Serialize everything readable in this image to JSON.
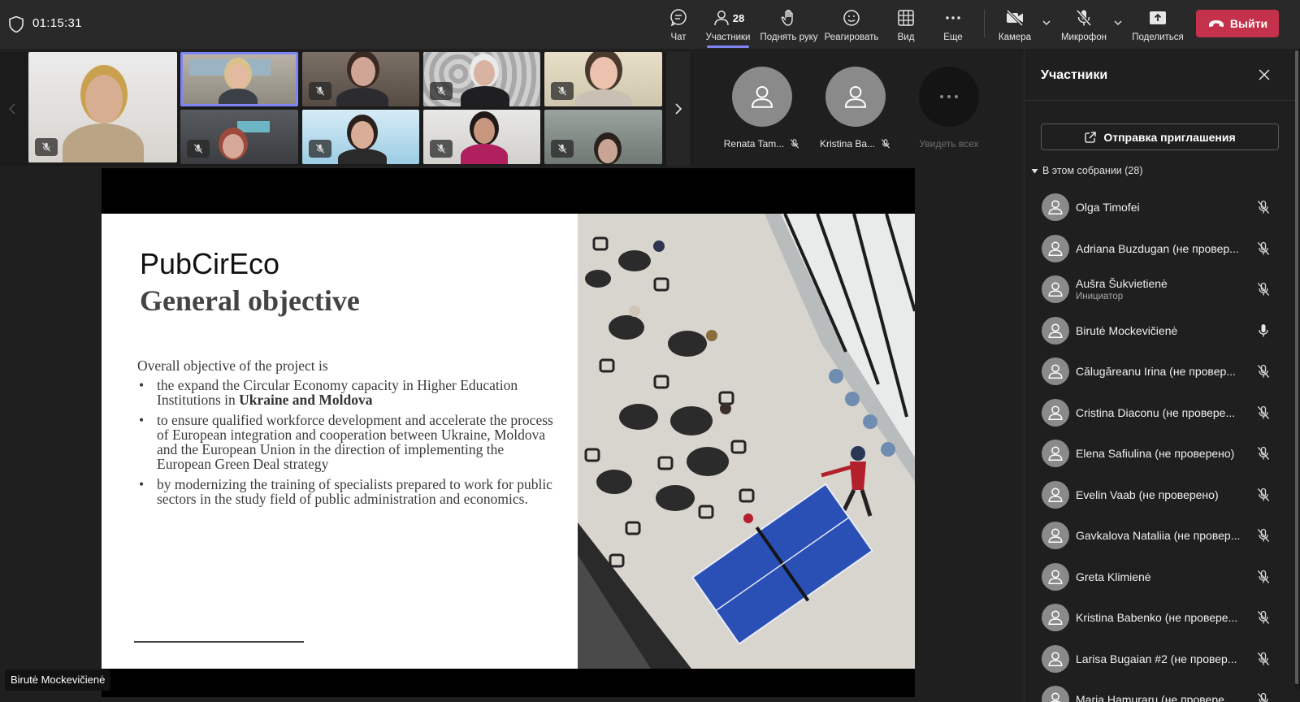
{
  "meeting": {
    "timer": "01:15:31"
  },
  "toolbar": {
    "chat_label": "Чат",
    "participants_label": "Участники",
    "participants_count": "28",
    "raise_hand_label": "Поднять руку",
    "react_label": "Реагировать",
    "view_label": "Вид",
    "more_label": "Еще",
    "camera_label": "Камера",
    "mic_label": "Микрофон",
    "share_label": "Поделиться",
    "leave_label": "Выйти",
    "leave_color": "#c4314b",
    "accent_color": "#7f85f5"
  },
  "stage": {
    "avatars": [
      {
        "name": "Renata Tam..."
      },
      {
        "name": "Kristina Ba..."
      }
    ],
    "see_all_label": "Увидеть всех",
    "presenter_name": "Birutė Mockevičienė"
  },
  "slide": {
    "title_line1": "PubCirEco",
    "title_line2": "General objective",
    "intro": "Overall objective of the project is",
    "bullets": [
      {
        "text": "the expand the Circular Economy capacity in Higher Education Institutions in ",
        "bold": "Ukraine and Moldova"
      },
      {
        "text": "to ensure qualified workforce development and accelerate the process of European integration and cooperation between Ukraine, Moldova and the European Union in the direction of implementing the European Green Deal strategy",
        "bold": ""
      },
      {
        "text": "by modernizing the training of specialists prepared to work for public sectors in the study field of public administration and economics.",
        "bold": ""
      }
    ]
  },
  "panel": {
    "title": "Участники",
    "invite_label": "Отправка приглашения",
    "section_label": "В этом собрании (28)",
    "participants": [
      {
        "name": "Olga Timofei",
        "sub": "",
        "mic": "off"
      },
      {
        "name": "Adriana Buzdugan (не провер...",
        "sub": "",
        "mic": "off"
      },
      {
        "name": "Aušra Šukvietienė",
        "sub": "Инициатор",
        "mic": "off"
      },
      {
        "name": "Birutė Mockevičienė",
        "sub": "",
        "mic": "on"
      },
      {
        "name": "Călugăreanu Irina (не провер...",
        "sub": "",
        "mic": "off"
      },
      {
        "name": "Cristina Diaconu (не провере...",
        "sub": "",
        "mic": "off"
      },
      {
        "name": "Elena Safiulina (не проверено)",
        "sub": "",
        "mic": "off"
      },
      {
        "name": "Evelin Vaab (не проверено)",
        "sub": "",
        "mic": "off"
      },
      {
        "name": "Gavkalova Nataliia (не провер...",
        "sub": "",
        "mic": "off"
      },
      {
        "name": "Greta Klimienė",
        "sub": "",
        "mic": "off"
      },
      {
        "name": "Kristina Babenko (не провере...",
        "sub": "",
        "mic": "off"
      },
      {
        "name": "Larisa Bugaian #2 (не провер...",
        "sub": "",
        "mic": "off"
      },
      {
        "name": "Maria Hamuraru (не провере...",
        "sub": "",
        "mic": "off"
      }
    ]
  }
}
